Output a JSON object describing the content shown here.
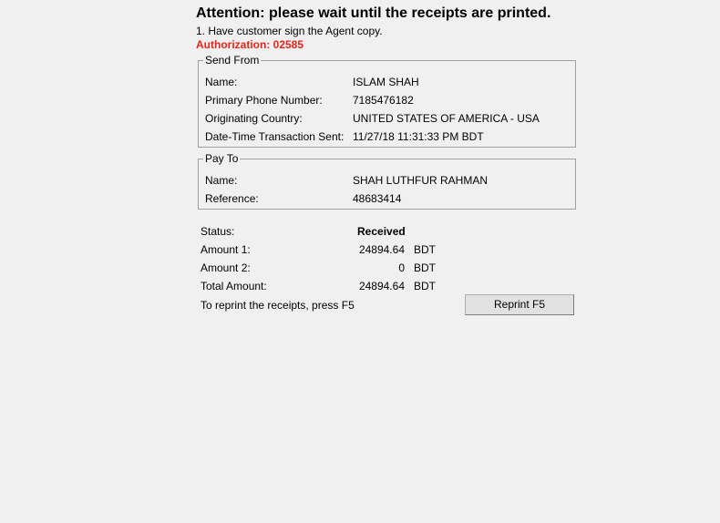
{
  "header": {
    "title": "Attention: please wait until the receipts are printed.",
    "instruction": "1.  Have customer sign the Agent copy.",
    "authorization": "Authorization: 02585"
  },
  "send_from": {
    "legend": "Send From",
    "fields": [
      {
        "label": "Name:",
        "value": "ISLAM SHAH"
      },
      {
        "label": "Primary Phone Number:",
        "value": "7185476182"
      },
      {
        "label": "Originating Country:",
        "value": "UNITED STATES OF AMERICA - USA"
      },
      {
        "label": "Date-Time Transaction Sent:",
        "value": "11/27/18 11:31:33 PM BDT"
      }
    ]
  },
  "pay_to": {
    "legend": "Pay To",
    "fields": [
      {
        "label": "Name:",
        "value": "SHAH LUTHFUR RAHMAN"
      },
      {
        "label": "Reference:",
        "value": "48683414"
      }
    ]
  },
  "summary": {
    "status_label": "Status:",
    "status_value": "Received",
    "amount1_label": "Amount 1:",
    "amount1_value": "24894.64",
    "amount1_currency": "BDT",
    "amount2_label": "Amount 2:",
    "amount2_value": "0",
    "amount2_currency": "BDT",
    "total_label": "Total Amount:",
    "total_value": "24894.64",
    "total_currency": "BDT"
  },
  "reprint": {
    "prompt": "To reprint the receipts, press F5",
    "button_label": "Reprint F5"
  },
  "colors": {
    "authorization": "#e8231a",
    "background": "#f0f0f0"
  }
}
